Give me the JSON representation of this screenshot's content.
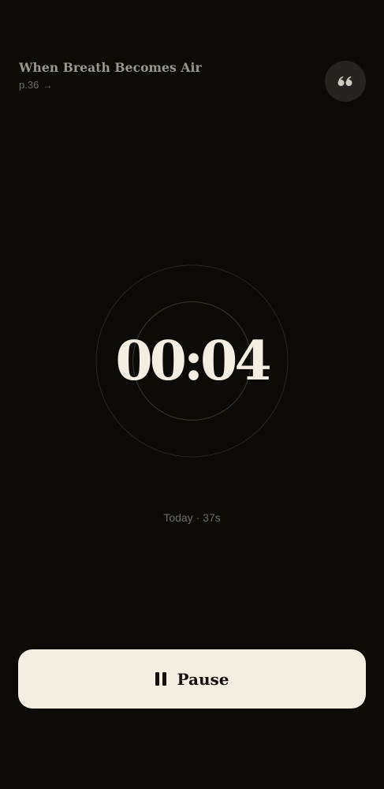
{
  "header": {
    "book_title": "When Breath Becomes Air",
    "page_label": "p.36",
    "page_arrow": "→",
    "quote_icon": "quote-icon"
  },
  "timer": {
    "display": "00:04"
  },
  "stats": {
    "today_text": "Today · 37s"
  },
  "controls": {
    "pause_label": "Pause",
    "pause_icon": "pause-icon"
  },
  "colors": {
    "background": "#0c0b08",
    "text_primary": "#f3ede2",
    "text_muted": "#6f6c66",
    "button_bg": "#f3ede2",
    "quote_button_bg": "#262421"
  }
}
